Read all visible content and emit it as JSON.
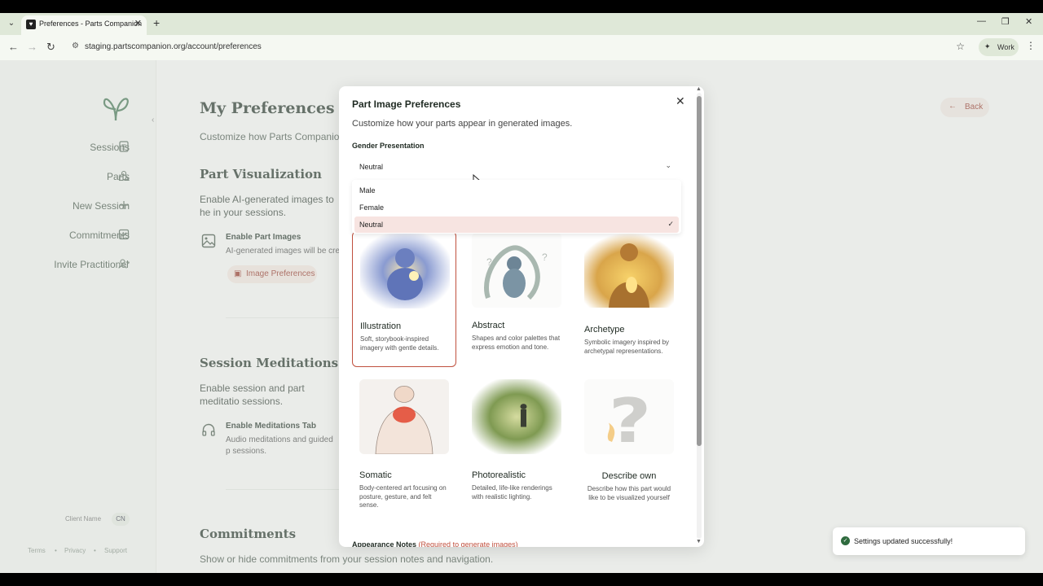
{
  "browser": {
    "tab_title": "Preferences - Parts Companion",
    "new_tab_label": "+",
    "url": "staging.partscompanion.org/account/preferences",
    "profile_label": "Work"
  },
  "sidebar": {
    "items": [
      {
        "label": "Sessions",
        "icon": "document-icon"
      },
      {
        "label": "Parts",
        "icon": "shapes-icon"
      },
      {
        "label": "New Session",
        "icon": "plus-icon"
      },
      {
        "label": "Commitments",
        "icon": "checkbox-icon"
      },
      {
        "label": "Invite Practitioner",
        "icon": "user-plus-icon"
      }
    ],
    "client_name": "Client Name",
    "client_initials": "CN",
    "footer": [
      "Terms",
      "Privacy",
      "Support"
    ],
    "footer_sep": "•"
  },
  "main": {
    "title": "My Preferences",
    "subtitle": "Customize how Parts Companion",
    "back_label": "Back",
    "sections": {
      "visualization": {
        "heading": "Part Visualization",
        "text": "Enable AI-generated images to he in your sessions.",
        "option_title": "Enable Part Images",
        "option_desc": "AI-generated images will be cre",
        "button": "Image Preferences"
      },
      "meditations": {
        "heading": "Session Meditations and",
        "text": "Enable session and part meditatio sessions.",
        "option_title": "Enable Meditations Tab",
        "option_desc": "Audio meditations and guided p sessions."
      },
      "commitments": {
        "heading": "Commitments",
        "text": "Show or hide commitments from your session notes and navigation."
      }
    }
  },
  "modal": {
    "title": "Part Image Preferences",
    "subtitle": "Customize how your parts appear in generated images.",
    "gender_label": "Gender Presentation",
    "gender_value": "Neutral",
    "gender_options": [
      "Male",
      "Female",
      "Neutral"
    ],
    "selected_option": "Neutral",
    "styles": [
      {
        "title": "Illustration",
        "desc": "Soft, storybook-inspired imagery with gentle details.",
        "selected": true
      },
      {
        "title": "Abstract",
        "desc": "Shapes and color palettes that express emotion and tone.",
        "selected": false
      },
      {
        "title": "Archetype",
        "desc": "Symbolic imagery inspired by archetypal representations.",
        "selected": false
      },
      {
        "title": "Somatic",
        "desc": "Body-centered art focusing on posture, gesture, and felt sense.",
        "selected": false
      },
      {
        "title": "Photorealistic",
        "desc": "Detailed, life-like renderings with realistic lighting.",
        "selected": false
      },
      {
        "title": "Describe own",
        "desc": "Describe how this part would like to be visualized yourself",
        "selected": false
      }
    ],
    "notes_label": "Appearance Notes",
    "notes_required": "(Required to generate images)"
  },
  "toast": {
    "message": "Settings updated successfully!"
  },
  "colors": {
    "accent": "#c0503e",
    "chrome": "#dfe8d8",
    "heading": "#2d3b32",
    "success": "#2f6b3f"
  }
}
